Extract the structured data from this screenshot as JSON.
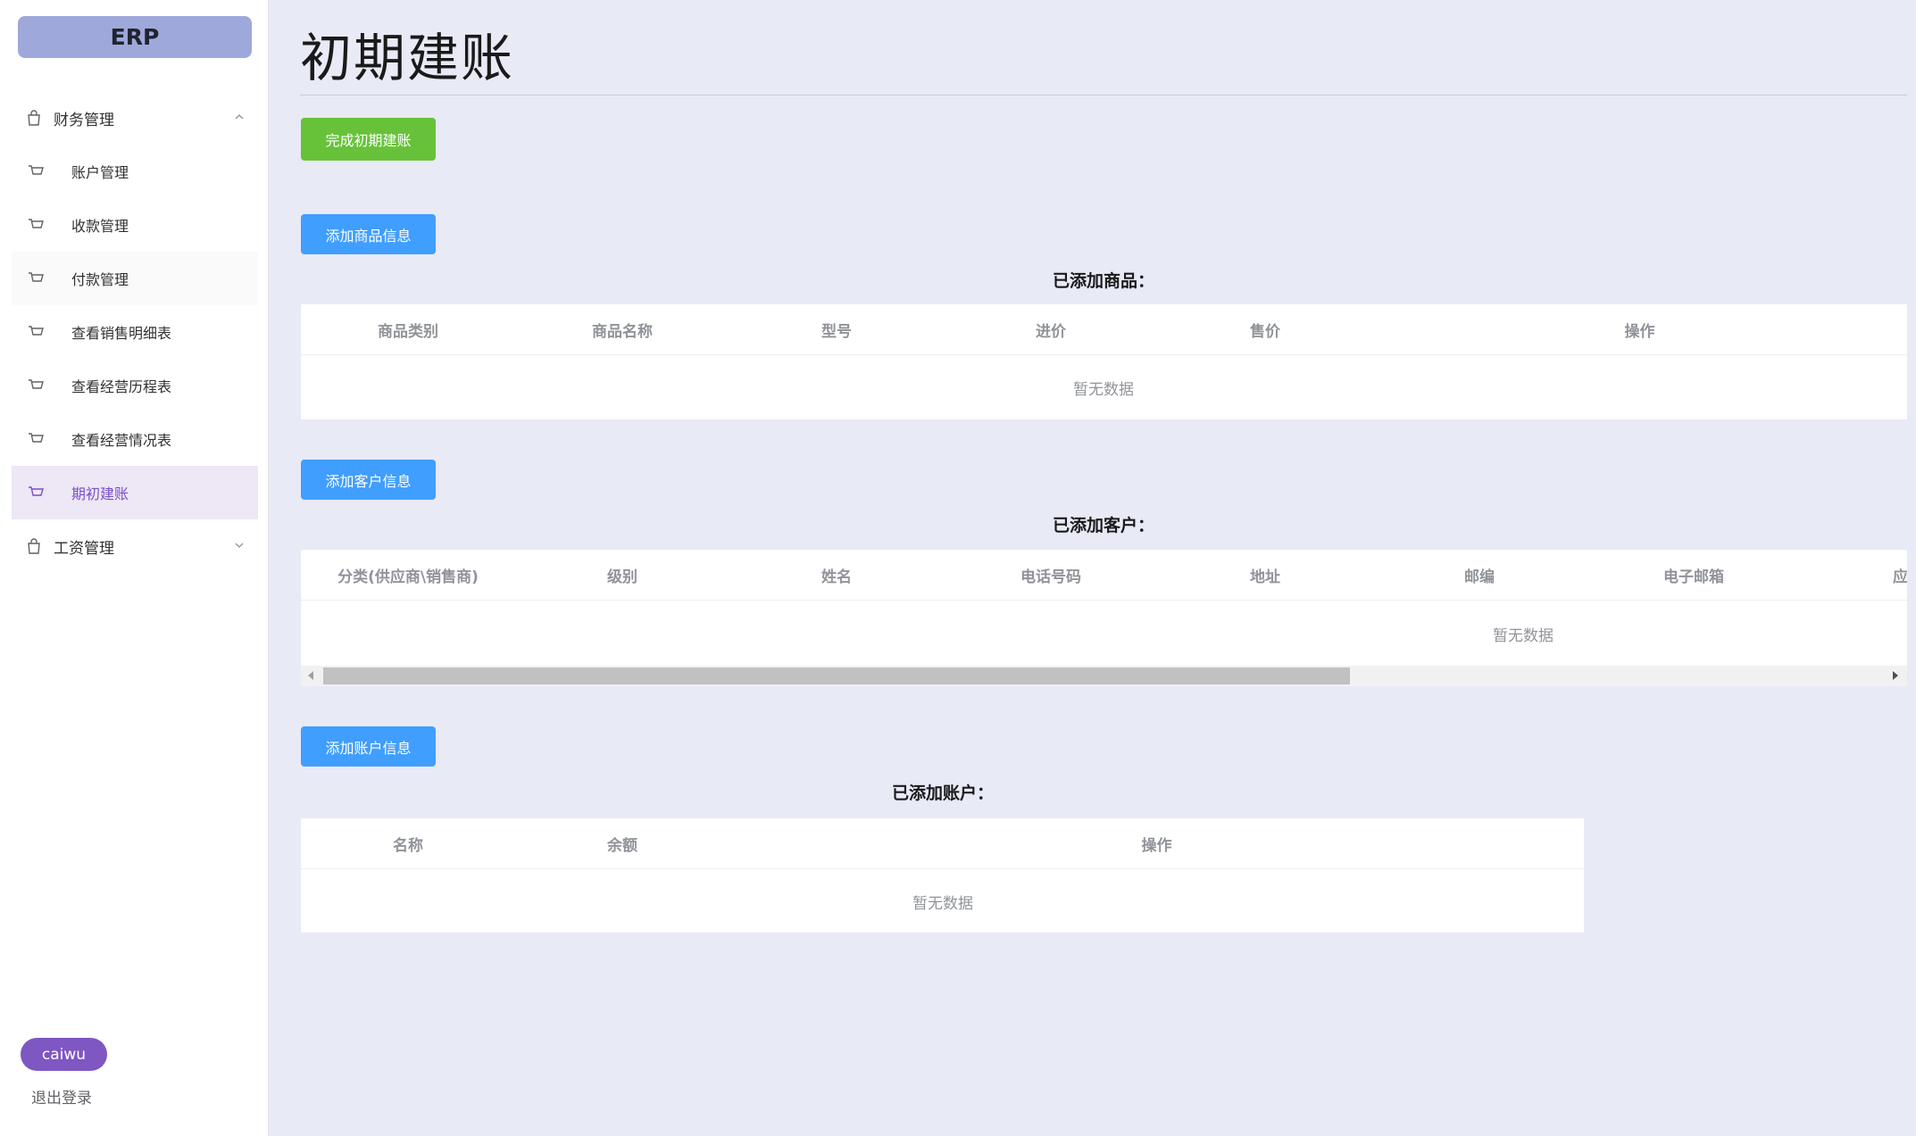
{
  "app": {
    "logo": "ERP"
  },
  "sidebar": {
    "groups": [
      {
        "label": "财务管理",
        "expanded": true
      },
      {
        "label": "工资管理",
        "expanded": false
      }
    ],
    "items": [
      {
        "label": "账户管理"
      },
      {
        "label": "收款管理"
      },
      {
        "label": "付款管理"
      },
      {
        "label": "查看销售明细表"
      },
      {
        "label": "查看经营历程表"
      },
      {
        "label": "查看经营情况表"
      },
      {
        "label": "期初建账",
        "active": true
      }
    ],
    "user": "caiwu",
    "logout": "退出登录"
  },
  "page": {
    "title": "初期建账",
    "complete_button": "完成初期建账",
    "empty_text": "暂无数据"
  },
  "goods": {
    "add_button": "添加商品信息",
    "label": "已添加商品：",
    "columns": [
      "商品类别",
      "商品名称",
      "型号",
      "进价",
      "售价",
      "操作"
    ]
  },
  "customers": {
    "add_button": "添加客户信息",
    "label": "已添加客户：",
    "columns": [
      "分类(供应商\\销售商)",
      "级别",
      "姓名",
      "电话号码",
      "地址",
      "邮编",
      "电子邮箱",
      "应收"
    ]
  },
  "accounts": {
    "add_button": "添加账户信息",
    "label": "已添加账户：",
    "columns": [
      "名称",
      "余额",
      "操作"
    ]
  },
  "colors": {
    "primary": "#409eff",
    "success": "#67c23a",
    "logo_bg": "#9fa8da",
    "active_bg": "#ede7f6",
    "active_text": "#7b4fc8",
    "user_badge": "#7e57c2",
    "page_bg": "#e8eaf6"
  }
}
